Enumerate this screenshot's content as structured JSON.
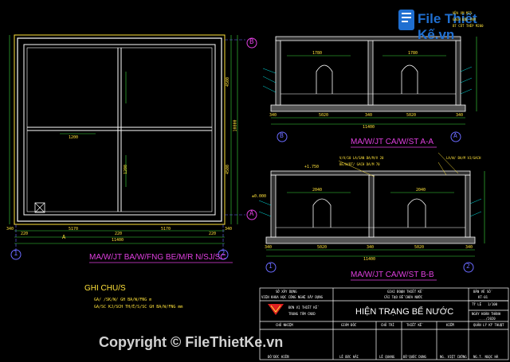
{
  "watermark": {
    "logo_text": "File Thiết Kế.vn",
    "copyright": "Copyright © FileThietKe.vn"
  },
  "plan": {
    "title": "MA/W/JT BA/W/FNG BE/M/R N/SJ/SC",
    "total_dim": "11400",
    "bottom_dims": [
      "340",
      "220",
      "5170",
      "220",
      "5170",
      "220",
      "340"
    ],
    "inner_dims": [
      "1200",
      "1200"
    ],
    "side_dims": [
      "4500",
      "4500",
      "10800"
    ],
    "axis_left": "1",
    "axis_right": "2",
    "axis_top": "B",
    "axis_bottom": "A",
    "axis_a_mark": "A"
  },
  "section_aa": {
    "title": "MA/W/JT CA/W/ST A-A",
    "total_dim": "11400",
    "dims": [
      "340",
      "5020",
      "340",
      "5020",
      "340"
    ],
    "top_dims": [
      "1780",
      "1780"
    ],
    "axis_left": "B",
    "axis_right": "A",
    "notes": [
      "VỮA XM M75",
      "GẠCH ĐẶC VXM",
      "BT CỐT THÉP M200"
    ]
  },
  "section_bb": {
    "title": "MA/W/JT CA/W/ST B-B",
    "total_dim": "11400",
    "dims": [
      "340",
      "5020",
      "340",
      "5020",
      "340"
    ],
    "top_dims": [
      "2040",
      "2040"
    ],
    "elev_top": "+1.750",
    "elev_base": "±0.000",
    "axis_left": "1",
    "axis_right": "2",
    "notes": [
      "V/V/10 LA/SAN BA/M/V 20",
      "BE/W/BT/ GACH DA/M 70",
      "LA/W/ BA/M VJ/GACH"
    ]
  },
  "notes": {
    "heading": "GHI CHU/S",
    "lines": [
      "GA/ /SK/W/ GH BA/W/FNG m",
      "GA/SC KJ/SCH TH/Ẽ/S/SC GH BA/W/FNG mm"
    ]
  },
  "title_block": {
    "owner_label": "SỞ XÂY DỰNG",
    "owner_org": "VIỆN KHOA HỌC CÔNG NGHỆ XÂY DỰNG",
    "project_label": "GIAI ĐOẠN THIẾT KẾ",
    "project_name": "CẢI TẠO BỂ CHỨA NƯỚC",
    "company_label": "ĐƠN VỊ THIẾT KẾ",
    "company_name": "TRUNG TÂM CNXD",
    "drawing_title": "HIỆN TRẠNG BỂ NƯỚC",
    "drawing_no_label": "BẢN VẼ SỐ",
    "drawing_no": "KT-01",
    "scale_label": "TỶ LỆ",
    "scale": "1/100",
    "date_label": "NGÀY HOÀN THÀNH",
    "date": "..../2020",
    "cols": [
      "CHỦ NHIỆM",
      "GIÁM ĐỐC",
      "CHỦ TRÌ",
      "THIẾT KẾ",
      "KIỂM",
      "QUẢN LÝ KỸ THUẬT"
    ],
    "names": [
      "ĐỖ ĐỨC HIỀN",
      "LÊ ĐỨC HẢI",
      "LÊ QUANG",
      "ĐỖ QUỐC DUNG",
      "NG. VIỆT CƯỜNG",
      "NG.T. NGỌC HÀ"
    ]
  },
  "colors": {
    "line_white": "#ffffff",
    "dim_green": "#3cdc3c",
    "hatch_cyan": "#00e0e0",
    "title_magenta": "#e03fe0",
    "note_yellow": "#ffe23a",
    "axis_blue": "#6a6aff",
    "watermark_blue": "#1f6fd1"
  }
}
